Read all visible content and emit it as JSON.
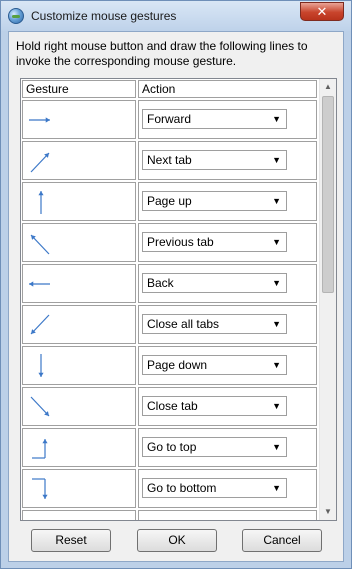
{
  "window": {
    "title": "Customize mouse gestures",
    "close_glyph": "✕",
    "icon": "browser-globe-icon"
  },
  "instructions": "Hold right mouse button and draw the following lines to invoke the corresponding mouse gesture.",
  "table": {
    "headers": {
      "gesture": "Gesture",
      "action": "Action"
    },
    "rows": [
      {
        "gesture": "right",
        "icon": "arrow-right-icon",
        "action": "Forward"
      },
      {
        "gesture": "up-right",
        "icon": "arrow-up-right-icon",
        "action": "Next tab"
      },
      {
        "gesture": "up",
        "icon": "arrow-up-icon",
        "action": "Page up"
      },
      {
        "gesture": "up-left",
        "icon": "arrow-up-left-icon",
        "action": "Previous tab"
      },
      {
        "gesture": "left",
        "icon": "arrow-left-icon",
        "action": "Back"
      },
      {
        "gesture": "down-left",
        "icon": "arrow-down-left-icon",
        "action": "Close all tabs"
      },
      {
        "gesture": "down",
        "icon": "arrow-down-icon",
        "action": "Page down"
      },
      {
        "gesture": "down-right",
        "icon": "arrow-down-right-icon",
        "action": "Close tab"
      },
      {
        "gesture": "down-then-up",
        "icon": "arrow-down-then-up-icon",
        "action": "Go to top"
      },
      {
        "gesture": "right-then-down",
        "icon": "arrow-right-then-down-icon",
        "action": "Go to bottom"
      },
      {
        "gesture": "",
        "icon": "",
        "action": ""
      }
    ]
  },
  "scrollbar": {
    "up_glyph": "▲",
    "down_glyph": "▼"
  },
  "dropdown_arrow": "▼",
  "buttons": {
    "reset": "Reset",
    "ok": "OK",
    "cancel": "Cancel"
  },
  "colors": {
    "gesture_arrow": "#3c78c8",
    "titlebar": "#bcd0e8",
    "close_button": "#c8442c"
  }
}
